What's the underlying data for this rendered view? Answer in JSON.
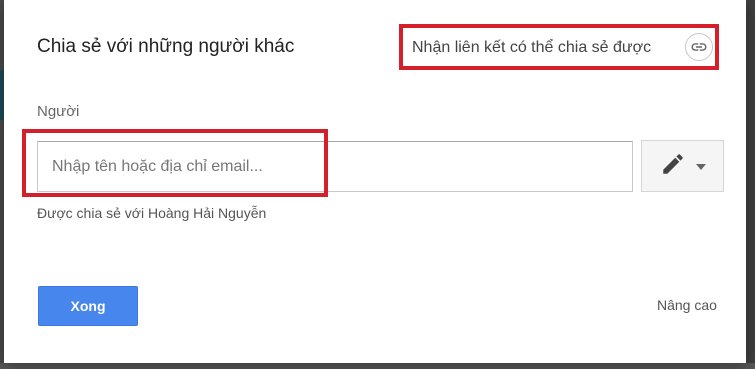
{
  "dialog": {
    "title": "Chia sẻ với những người khác",
    "share_link": {
      "label": "Nhận liên kết có thể chia sẻ được",
      "icon": "link-icon"
    },
    "people_label": "Người",
    "email_input": {
      "placeholder": "Nhập tên hoặc địa chỉ email...",
      "value": ""
    },
    "permission_button": {
      "icon": "pencil-icon",
      "dropdown_icon": "caret-down-icon"
    },
    "shared_with_text": "Được chia sẻ với Hoàng Hải Nguyễn",
    "done_label": "Xong",
    "advanced_label": "Nâng cao"
  },
  "colors": {
    "highlight": "#d3202a",
    "primary_button": "#4787ed"
  }
}
